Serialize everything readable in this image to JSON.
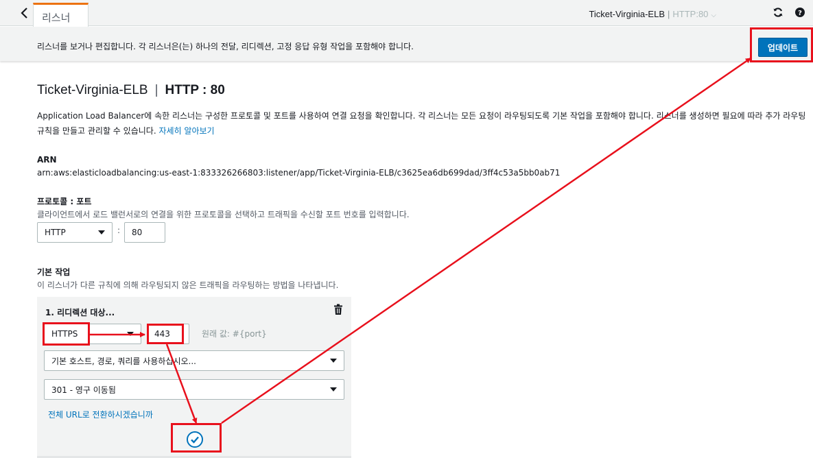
{
  "header": {
    "tab_label": "리스너",
    "lb_name": "Ticket-Virginia-ELB",
    "separator": "|",
    "protocol_port": "HTTP:80"
  },
  "infobar": {
    "text": "리스너를 보거나 편집합니다. 각 리스너은(는) 하나의 전달, 리디렉션, 고정 응답 유형 작업을 포함해야 합니다.",
    "update_label": "업데이트"
  },
  "main": {
    "title_name": "Ticket-Virginia-ELB",
    "title_sep": "|",
    "title_proto": "HTTP : 80",
    "description": "Application Load Balancer에 속한 리스너는 구성한 프로토콜 및 포트를 사용하여 연결 요청을 확인합니다. 각 리스너는 모든 요청이 라우팅되도록 기본 작업을 포함해야 합니다. 리스너를 생성하면 필요에 따라 추가 라우팅 규칙을 만들고 관리할 수 있습니다.",
    "learn_more": "자세히 알아보기",
    "arn_label": "ARN",
    "arn_value": "arn:aws:elasticloadbalancing:us-east-1:833326266803:listener/app/Ticket-Virginia-ELB/c3625ea6db699dad/3ff4c53a5bb0ab71",
    "protocol_port_label": "프로토콜 : 포트",
    "protocol_port_desc": "클라이언트에서 로드 밸런서로의 연결을 위한 프로토콜을 선택하고 트래픽을 수신할 포트 번호를 입력합니다.",
    "protocol_value": "HTTP",
    "port_value": "80",
    "colon": ":",
    "default_action_label": "기본 작업",
    "default_action_desc": "이 리스너가 다른 규칙에 의해 라우팅되지 않은 트래픽을 라우팅하는 방법을 나타냅니다."
  },
  "action": {
    "title": "1. 리디렉션 대상...",
    "redirect_protocol": "HTTPS",
    "redirect_port": "443",
    "original_value": "원래 값: #{port}",
    "host_path_option": "기본 호스트, 경로, 쿼리를 사용하십시오...",
    "status_code_option": "301 - 영구 이동됨",
    "full_url_link": "전체 URL로 전환하시겠습니까"
  },
  "colors": {
    "accent": "#0073bb",
    "tab_highlight": "#ec7211",
    "annotation": "#e8101c"
  }
}
